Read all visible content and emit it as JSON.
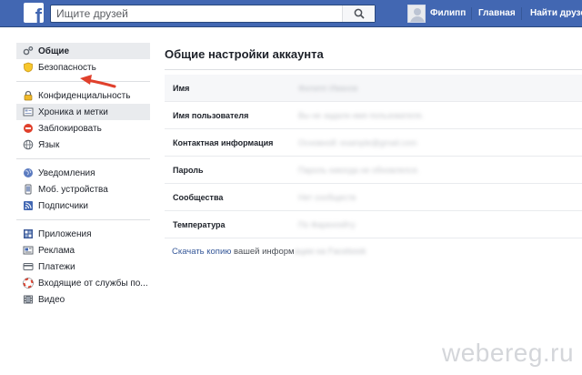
{
  "topbar": {
    "logo": "f",
    "search_placeholder": "Ищите друзей",
    "user_name": "Филипп",
    "home_label": "Главная",
    "find_friends_label": "Найти друзей"
  },
  "sidebar": {
    "groups": [
      [
        {
          "label": "Общие",
          "icon": "gear-icon",
          "active": true
        },
        {
          "label": "Безопасность",
          "icon": "shield-icon",
          "active": false
        }
      ],
      [
        {
          "label": "Конфиденциальность",
          "icon": "lock-icon",
          "active": false
        },
        {
          "label": "Хроника и метки",
          "icon": "timeline-icon",
          "active": false
        },
        {
          "label": "Заблокировать",
          "icon": "block-icon",
          "active": false
        },
        {
          "label": "Язык",
          "icon": "globe-icon",
          "active": false
        }
      ],
      [
        {
          "label": "Уведомления",
          "icon": "globe-notifications-icon",
          "active": false
        },
        {
          "label": "Моб. устройства",
          "icon": "mobile-icon",
          "active": false
        },
        {
          "label": "Подписчики",
          "icon": "rss-icon",
          "active": false
        }
      ],
      [
        {
          "label": "Приложения",
          "icon": "apps-icon",
          "active": false
        },
        {
          "label": "Реклама",
          "icon": "ads-icon",
          "active": false
        },
        {
          "label": "Платежи",
          "icon": "payments-icon",
          "active": false
        },
        {
          "label": "Входящие от службы по...",
          "icon": "support-icon",
          "active": false
        },
        {
          "label": "Видео",
          "icon": "video-icon",
          "active": false
        }
      ]
    ]
  },
  "main": {
    "title": "Общие настройки аккаунта",
    "rows": [
      {
        "label": "Имя",
        "value": "Филипп Иванов"
      },
      {
        "label": "Имя пользователя",
        "value": "Вы не задали имя пользователя."
      },
      {
        "label": "Контактная информация",
        "value": "Основной: example@gmail.com"
      },
      {
        "label": "Пароль",
        "value": "Пароль никогда не обновлялся."
      },
      {
        "label": "Сообщества",
        "value": "Нет сообществ"
      },
      {
        "label": "Температура",
        "value": "По Фаренгейту"
      }
    ],
    "download_link": "Скачать копию",
    "download_rest": "вашей информ",
    "download_blur": "ации на Facebook"
  },
  "colors": {
    "topbar": "#4267b2",
    "link": "#365899",
    "arrow": "#e0402c"
  },
  "watermark": "webereg.ru"
}
